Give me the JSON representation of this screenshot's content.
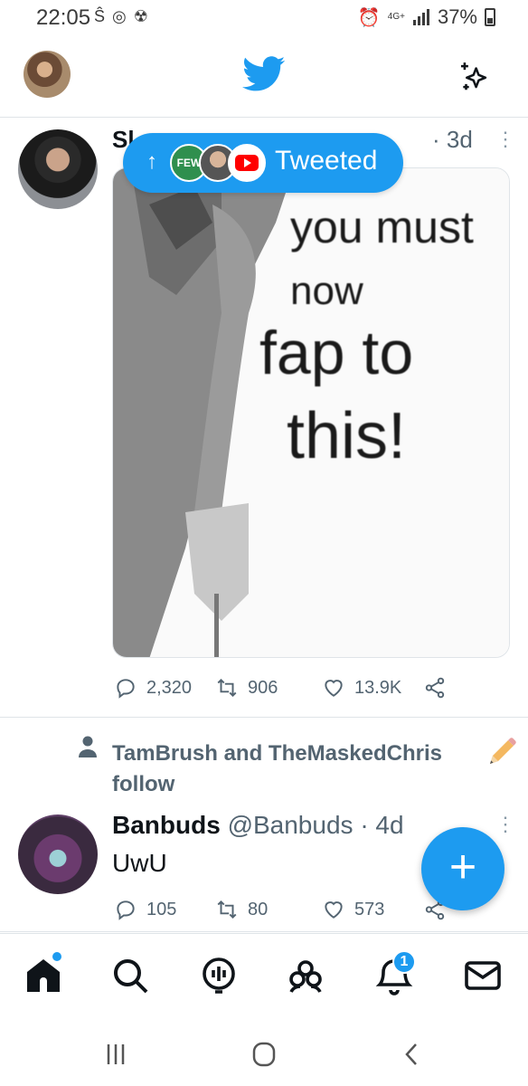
{
  "status_bar": {
    "time": "22:05",
    "network": "4G+",
    "battery": "37%"
  },
  "tweet1": {
    "name": "Sl",
    "time": "· 3d",
    "pill_text": "Tweeted",
    "pill_avatar_text": "FEW",
    "media_text": [
      "you must",
      "now",
      "fap to",
      "this!"
    ],
    "replies": "2,320",
    "retweets": "906",
    "likes": "13.9K"
  },
  "follow_context": {
    "text": "TamBrush and TheMaskedChris follow"
  },
  "tweet2": {
    "name": "Banbuds",
    "handle": "@Banbuds",
    "time": "· 4d",
    "body": "UwU",
    "replies": "105",
    "retweets": "80",
    "likes": "573"
  },
  "nav": {
    "notifications_count": "1"
  },
  "colors": {
    "accent": "#1d9bf0",
    "text": "#0f1419",
    "secondary": "#536471"
  }
}
